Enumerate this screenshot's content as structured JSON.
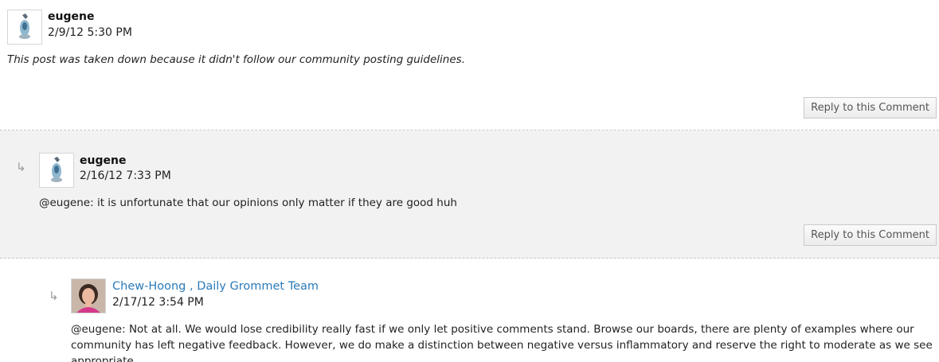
{
  "comments": [
    {
      "author": "eugene",
      "date": "2/9/12 5:30 PM",
      "text": "This post was taken down because it didn't follow our community posting guidelines.",
      "reply_label": "Reply to this Comment"
    },
    {
      "author": "eugene",
      "date": "2/16/12 7:33 PM",
      "text": "@eugene: it is unfortunate that our opinions only matter if they are good huh",
      "reply_label": "Reply to this Comment",
      "reply_arrow": "↳"
    },
    {
      "author": "Chew-Hoong , Daily Grommet Team",
      "date": "2/17/12 3:54 PM",
      "text": "@eugene: Not at all. We would lose credibility really fast if we only let positive comments stand. Browse our boards, there are plenty of examples where our community has left negative feedback. However, we do make a distinction between negative versus inflammatory and reserve the right to moderate as we see appropriate.",
      "reply_arrow": "↳"
    }
  ]
}
